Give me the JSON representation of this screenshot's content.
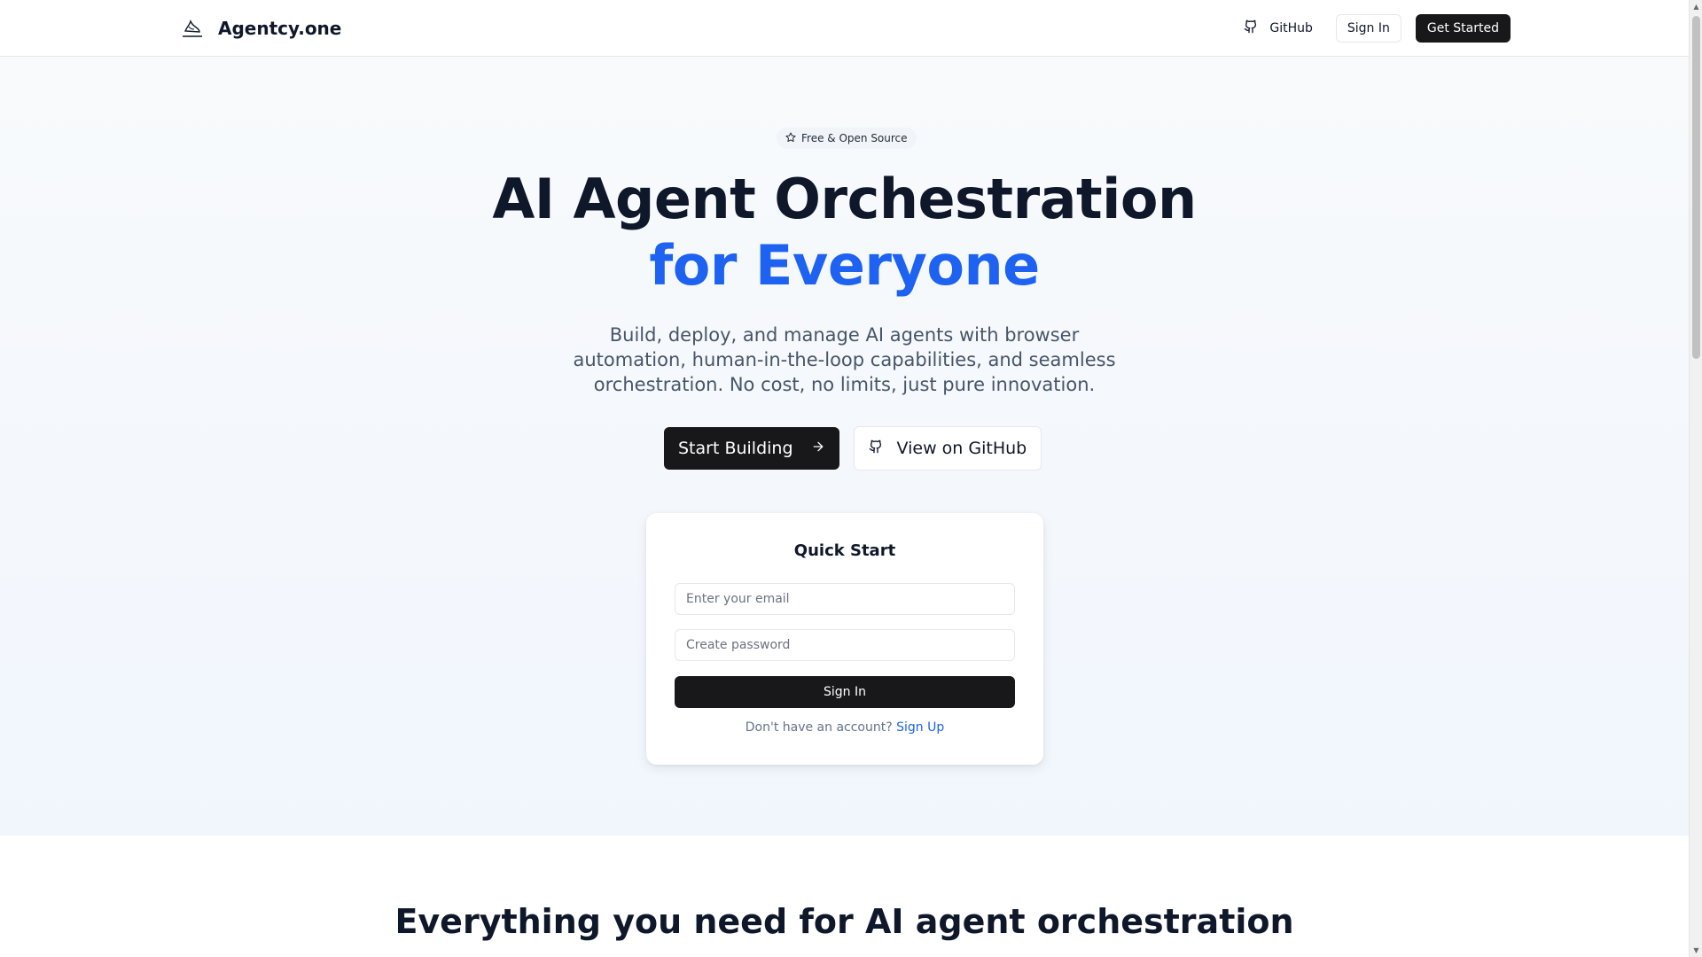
{
  "header": {
    "brand_name": "Agentcy.one",
    "logo_icon": "agentcy-logo-icon",
    "github_label": "GitHub",
    "signin_label": "Sign In",
    "get_started_label": "Get Started"
  },
  "hero": {
    "badge_label": "Free & Open Source",
    "title_line1": "AI Agent Orchestration",
    "title_line2": "for Everyone",
    "subtitle": "Build, deploy, and manage AI agents with browser automation, human-in-the-loop capabilities, and seamless orchestration. No cost, no limits, just pure innovation.",
    "primary_cta": "Start Building",
    "secondary_cta": "View on GitHub"
  },
  "quick_start": {
    "title": "Quick Start",
    "email_placeholder": "Enter your email",
    "password_placeholder": "Create password",
    "signin_label": "Sign In",
    "no_account_text": "Don't have an account?",
    "signup_label": "Sign Up"
  },
  "features": {
    "title": "Everything you need for AI agent orchestration"
  },
  "colors": {
    "accent_blue": "#1d62f0",
    "dark": "#18181b",
    "text_primary": "#0f172a",
    "text_muted": "#475569"
  }
}
